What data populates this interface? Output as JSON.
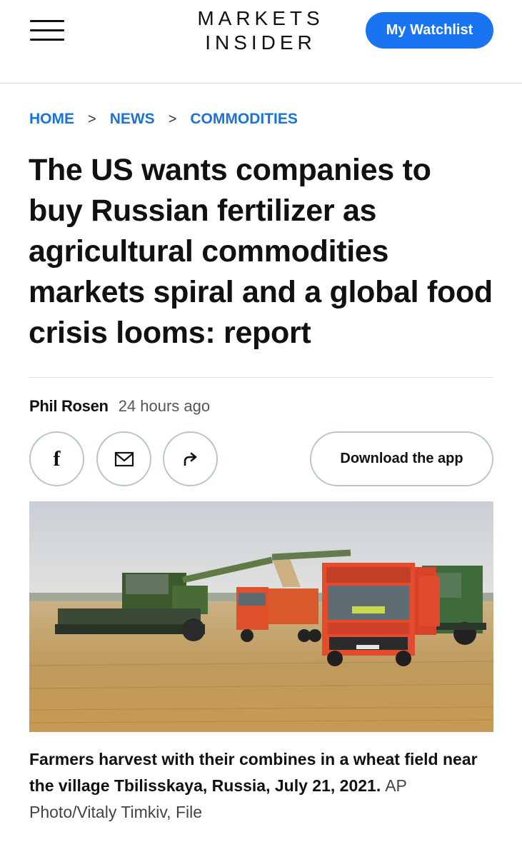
{
  "header": {
    "logo_line1": "MARKETS",
    "logo_line2": "INSIDER",
    "watchlist_label": "My Watchlist",
    "menu_icon": "hamburger-menu-icon"
  },
  "breadcrumb": {
    "items": [
      "HOME",
      "NEWS",
      "COMMODITIES"
    ],
    "separator": ">"
  },
  "article": {
    "headline": "The US wants companies to buy Russian fertilizer as agricultural commodities markets spiral and a global food crisis looms: report",
    "author": "Phil Rosen",
    "timestamp": "24 hours ago",
    "facebook_glyph": "f",
    "download_label": "Download the app",
    "share_icons": [
      "facebook-icon",
      "mail-icon",
      "share-arrow-icon"
    ]
  },
  "image": {
    "caption": "Farmers harvest with their combines in a wheat field near the village Tbilisskaya, Russia, July 21, 2021.",
    "credit": "AP Photo/Vitaly Timkiv, File"
  },
  "colors": {
    "accent": "#1a73f0",
    "link": "#1a73d9",
    "border": "#b6c6c9",
    "text": "#111111"
  }
}
